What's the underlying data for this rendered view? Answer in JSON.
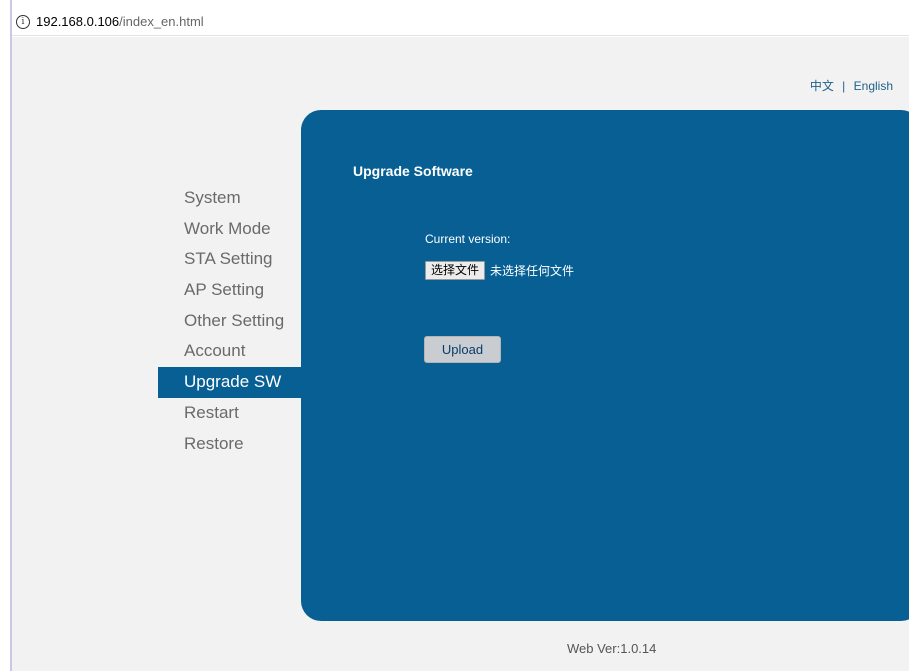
{
  "browser": {
    "url_host": "192.168.0.106",
    "url_path": "/index_en.html",
    "info_icon": "info-icon"
  },
  "language": {
    "chinese": "中文",
    "separator": "|",
    "english": "English"
  },
  "menu": {
    "items": [
      {
        "label": "System"
      },
      {
        "label": "Work Mode"
      },
      {
        "label": "STA Setting"
      },
      {
        "label": "AP Setting"
      },
      {
        "label": "Other Setting"
      },
      {
        "label": "Account"
      },
      {
        "label": "Upgrade SW",
        "active": true
      },
      {
        "label": "Restart"
      },
      {
        "label": "Restore"
      }
    ]
  },
  "panel": {
    "title": "Upgrade Software",
    "current_version_label": "Current version:",
    "file_button_label": "选择文件",
    "file_status": "未选择任何文件",
    "upload_label": "Upload"
  },
  "footer": {
    "web_version": "Web Ver:1.0.14"
  },
  "colors": {
    "accent": "#075f93",
    "background": "#f2f2f2"
  }
}
